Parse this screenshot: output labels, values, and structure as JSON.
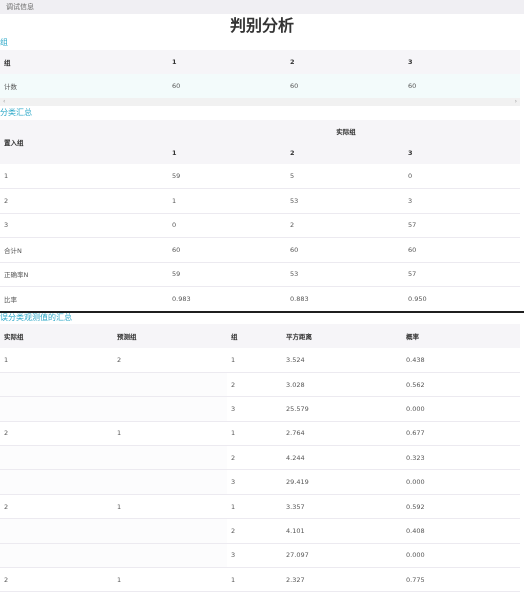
{
  "debug_label": "调试信息",
  "page_title": "判别分析",
  "table1": {
    "title": "组",
    "header": {
      "label": "组",
      "cols": [
        "1",
        "2",
        "3"
      ]
    },
    "row": {
      "label": "计数",
      "values": [
        "60",
        "60",
        "60"
      ]
    }
  },
  "table2": {
    "title": "分类汇总",
    "actual_group": "实际组",
    "corner_label": "置入组",
    "cols": [
      "1",
      "2",
      "3"
    ],
    "rows": [
      {
        "label": "1",
        "values": [
          "59",
          "5",
          "0"
        ]
      },
      {
        "label": "2",
        "values": [
          "1",
          "53",
          "3"
        ]
      },
      {
        "label": "3",
        "values": [
          "0",
          "2",
          "57"
        ]
      },
      {
        "label": "合计N",
        "values": [
          "60",
          "60",
          "60"
        ]
      },
      {
        "label": "正确率N",
        "values": [
          "59",
          "53",
          "57"
        ]
      },
      {
        "label": "比率",
        "values": [
          "0.983",
          "0.883",
          "0.950"
        ]
      }
    ]
  },
  "table3": {
    "title": "误分类观测值的汇总",
    "headers": [
      "实际组",
      "预测组",
      "组",
      "平方距离",
      "概率"
    ],
    "rows": [
      [
        "1",
        "2",
        "1",
        "3.524",
        "0.438"
      ],
      [
        "",
        "",
        "2",
        "3.028",
        "0.562"
      ],
      [
        "",
        "",
        "3",
        "25.579",
        "0.000"
      ],
      [
        "2",
        "1",
        "1",
        "2.764",
        "0.677"
      ],
      [
        "",
        "",
        "2",
        "4.244",
        "0.323"
      ],
      [
        "",
        "",
        "3",
        "29.419",
        "0.000"
      ],
      [
        "2",
        "1",
        "1",
        "3.357",
        "0.592"
      ],
      [
        "",
        "",
        "2",
        "4.101",
        "0.408"
      ],
      [
        "",
        "",
        "3",
        "27.097",
        "0.000"
      ],
      [
        "2",
        "1",
        "1",
        "2.327",
        "0.775"
      ]
    ]
  },
  "scroll": {
    "left_arrow": "‹",
    "right_arrow": "›"
  }
}
